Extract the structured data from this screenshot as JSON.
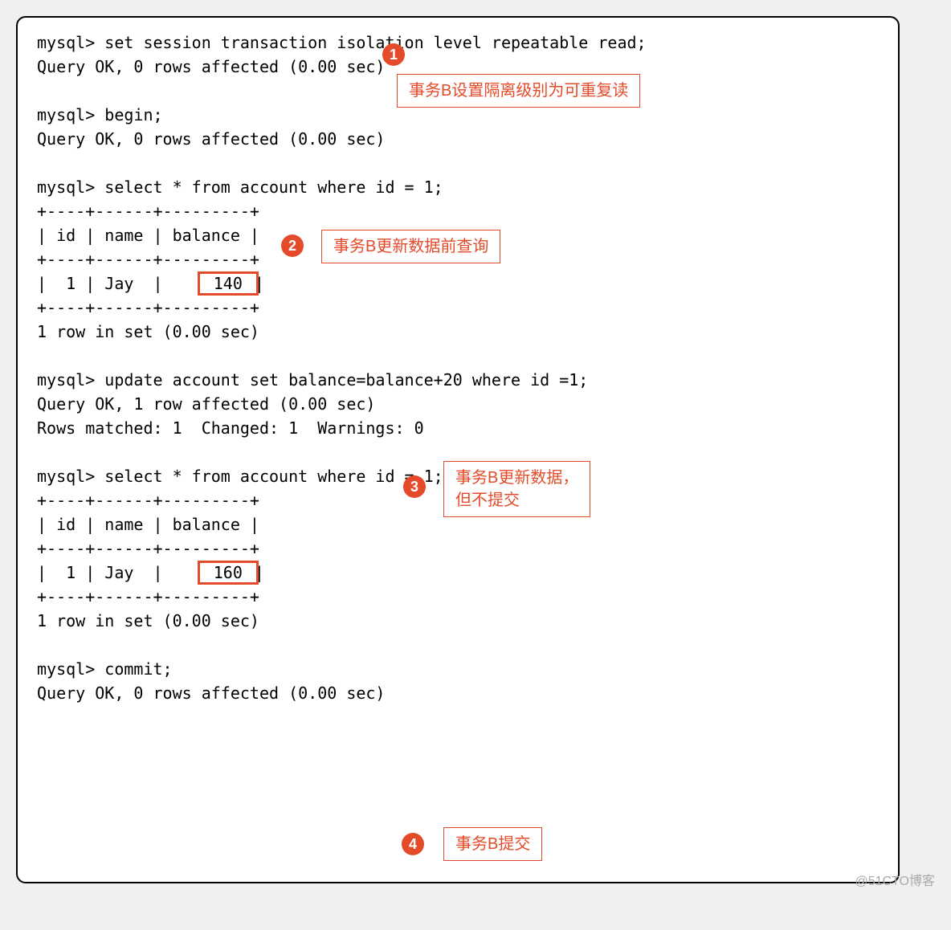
{
  "terminal": {
    "lines": [
      "mysql> set session transaction isolation level repeatable read;",
      "Query OK, 0 rows affected (0.00 sec)",
      "",
      "mysql> begin;",
      "Query OK, 0 rows affected (0.00 sec)",
      "",
      "mysql> select * from account where id = 1;",
      "+----+------+---------+",
      "| id | name | balance |",
      "+----+------+---------+",
      "|  1 | Jay  |     140 |",
      "+----+------+---------+",
      "1 row in set (0.00 sec)",
      "",
      "mysql> update account set balance=balance+20 where id =1;",
      "Query OK, 1 row affected (0.00 sec)",
      "Rows matched: 1  Changed: 1  Warnings: 0",
      "",
      "mysql> select * from account where id = 1;",
      "+----+------+---------+",
      "| id | name | balance |",
      "+----+------+---------+",
      "|  1 | Jay  |     160 |",
      "+----+------+---------+",
      "1 row in set (0.00 sec)",
      "",
      "mysql> commit;",
      "Query OK, 0 rows affected (0.00 sec)"
    ]
  },
  "row1_pre": "|  1 | Jay  |    ",
  "row1_val": " 140 ",
  "row1_post": "|",
  "row2_pre": "|  1 | Jay  |    ",
  "row2_val": " 160 ",
  "row2_post": "|",
  "badges": {
    "b1": "1",
    "b2": "2",
    "b3": "3",
    "b4": "4"
  },
  "annotations": {
    "a1": "事务B设置隔离级别为可重复读",
    "a2": "事务B更新数据前查询",
    "a3": "事务B更新数据，\n但不提交",
    "a4": "事务B提交"
  },
  "watermark": "@51CTO博客"
}
